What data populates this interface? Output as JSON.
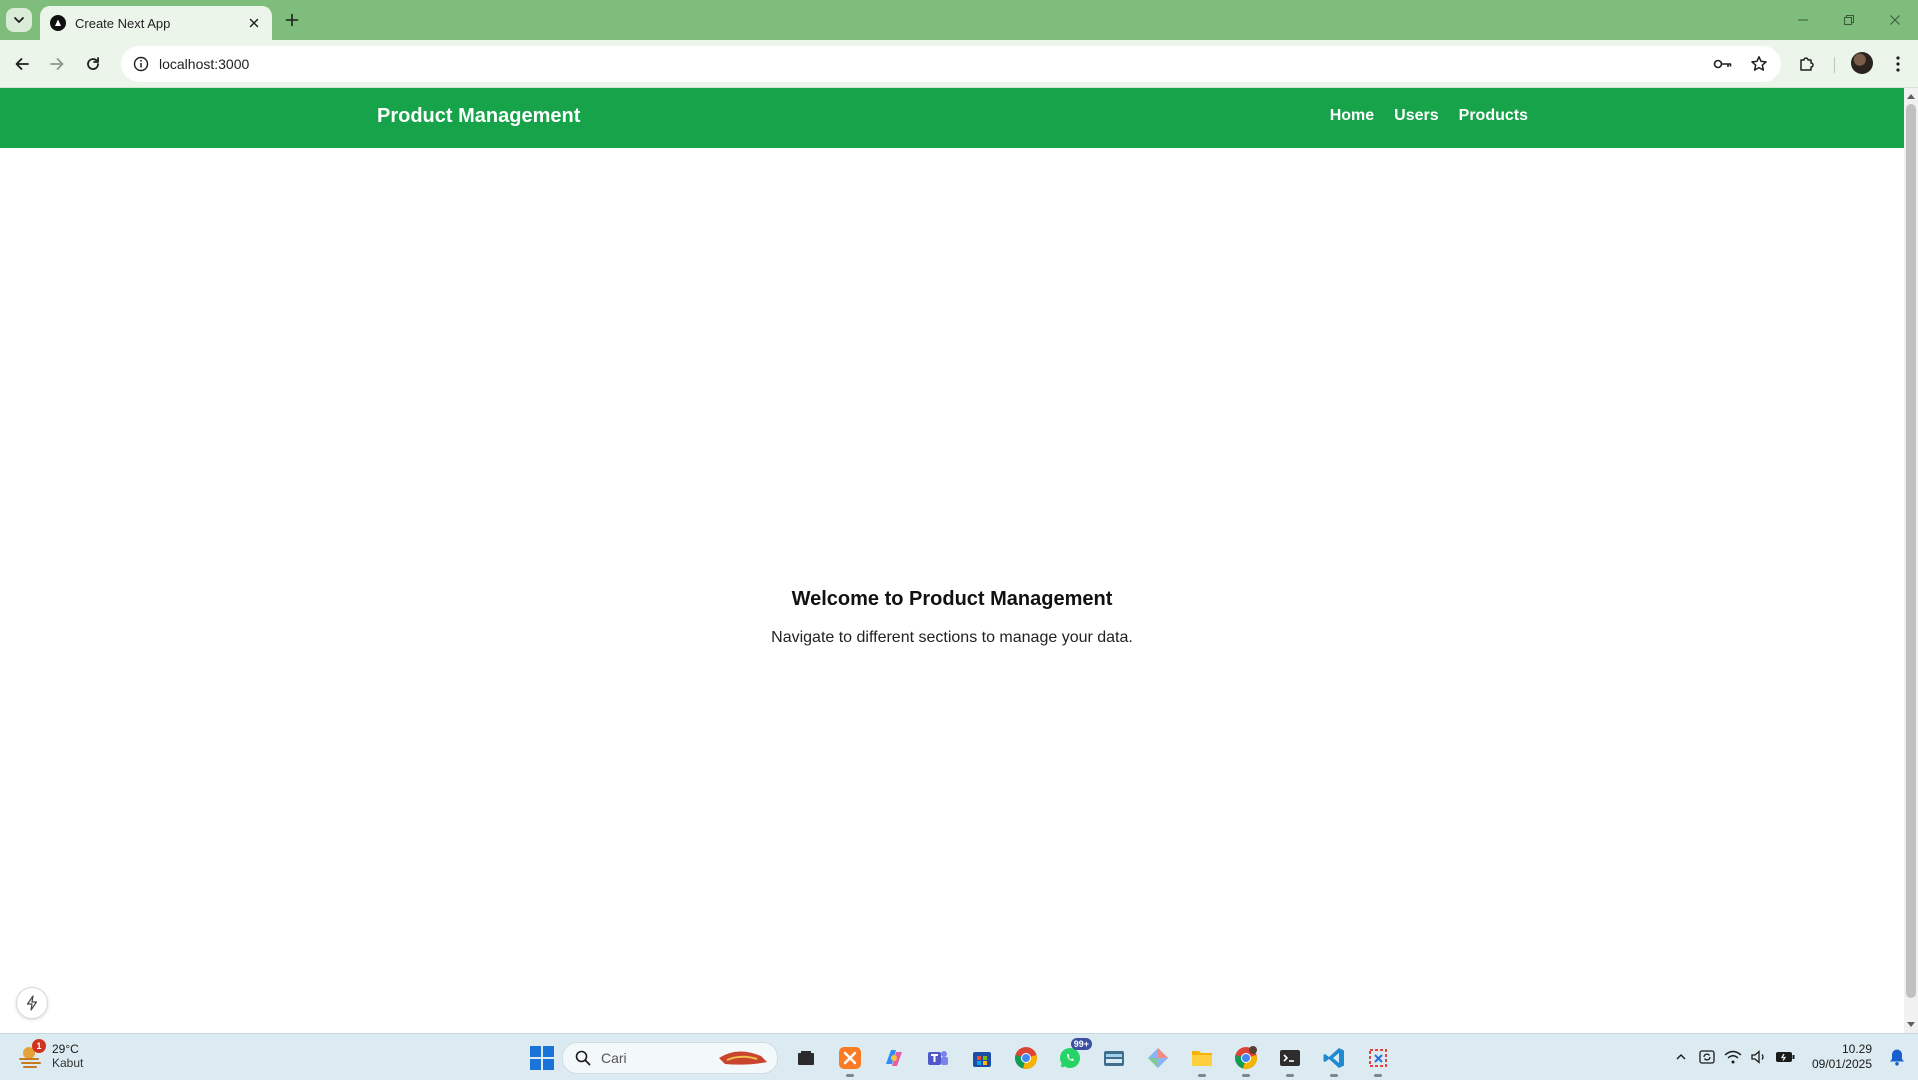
{
  "browser": {
    "tab_title": "Create Next App",
    "url": "localhost:3000"
  },
  "app": {
    "brand": "Product Management",
    "nav": [
      {
        "label": "Home"
      },
      {
        "label": "Users"
      },
      {
        "label": "Products"
      }
    ],
    "accent_color": "#16a34a",
    "hero_title": "Welcome to Product Management",
    "hero_subtitle": "Navigate to different sections to manage your data."
  },
  "taskbar": {
    "weather_temp": "29°C",
    "weather_condition": "Kabut",
    "weather_badge": "1",
    "search_placeholder": "Cari",
    "whatsapp_badge": "99+",
    "time": "10.29",
    "date": "09/01/2025"
  },
  "icons": {
    "tab_list": "chevron-down-icon",
    "close": "close-icon",
    "new_tab": "plus-icon",
    "back": "arrow-left-icon",
    "forward": "arrow-right-icon",
    "reload": "reload-icon",
    "site_info": "info-icon",
    "password": "key-icon",
    "bookmark": "star-icon",
    "extensions": "puzzle-icon",
    "menu": "kebab-menu-icon"
  }
}
